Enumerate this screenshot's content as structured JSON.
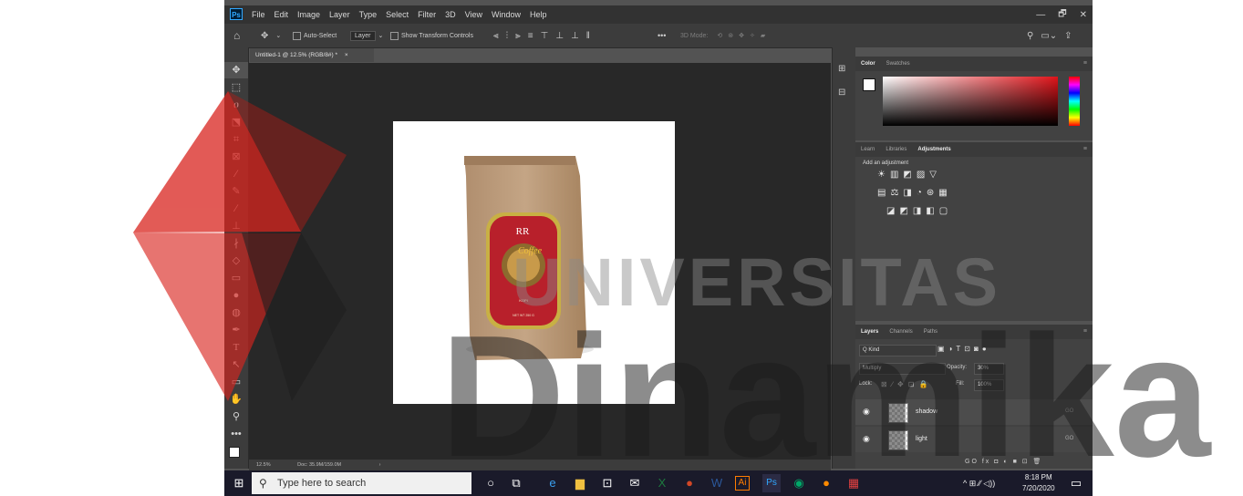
{
  "app": {
    "logo": "Ps"
  },
  "menu": [
    "File",
    "Edit",
    "Image",
    "Layer",
    "Type",
    "Select",
    "Filter",
    "3D",
    "View",
    "Window",
    "Help"
  ],
  "window_controls": [
    "—",
    "🗗",
    "✕"
  ],
  "options": {
    "auto_select_label": "Auto-Select",
    "auto_select_value": "Layer",
    "show_transform_label": "Show Transform Controls",
    "more": "•••",
    "mode_3d": "3D Mode:"
  },
  "document": {
    "tab_title": "Untitled-1 @ 12.5% (RGB/8#) *",
    "close": "×",
    "status_zoom": "12.5%",
    "status_doc": "Doc: 35.9M/159.0M",
    "status_arrow": "›"
  },
  "product": {
    "logo_mark": "RR",
    "brand_script": "Coffee",
    "small_text": "KOPI",
    "footer_text": "NET WT 250 G"
  },
  "color_panel": {
    "tabs": [
      "Color",
      "Swatches"
    ],
    "active": 0
  },
  "adjust_panel": {
    "tabs": [
      "Learn",
      "Libraries",
      "Adjustments"
    ],
    "active": 2,
    "hint": "Add an adjustment"
  },
  "layers_panel": {
    "tabs": [
      "Layers",
      "Channels",
      "Paths"
    ],
    "active": 0,
    "filter": "Q Kind",
    "blend_mode": "Multiply",
    "opacity_label": "Opacity:",
    "opacity_value": "30%",
    "lock_label": "Lock:",
    "fill_label": "Fill:",
    "fill_value": "100%",
    "layers": [
      {
        "name": "shadow",
        "link": "GO"
      },
      {
        "name": "light",
        "link": "GO"
      }
    ],
    "footer_icons": "GO  fx  ◘  ◐  ■  ⊡  🗑"
  },
  "taskbar": {
    "search_placeholder": "Type here to search",
    "time": "8:18 PM",
    "date": "7/20/2020",
    "tray": "^  ⊞  ∕∕  ◁))"
  },
  "watermark": {
    "line1": "UNIVERSITAS",
    "line2": "Dinamika",
    "colors": {
      "red": "#d9241e",
      "black": "#1c1c1c",
      "gray": "#7a7a7a"
    }
  }
}
